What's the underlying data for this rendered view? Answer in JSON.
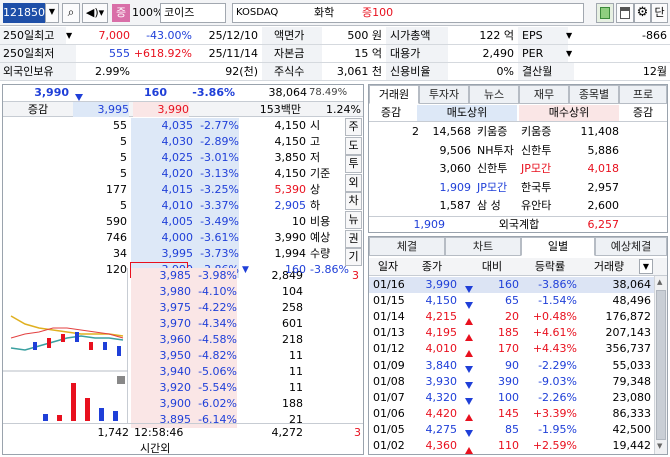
{
  "toolbar": {
    "code": "121850",
    "badge": "증",
    "margin": "100%",
    "name": "코이즈",
    "market": "KOSDAQ",
    "sector": "화학",
    "margin_text": "증100",
    "right_btn": "단"
  },
  "info": {
    "row1": {
      "label": "250일최고",
      "value": "7,000",
      "pct": "-43.00%",
      "date": "25/12/10",
      "k1": "액면가",
      "v1": "500 원",
      "k2": "시가총액",
      "v2": "122 억",
      "k3": "EPS",
      "v3": "-866"
    },
    "row2": {
      "label": "250일최저",
      "value": "555",
      "pct": "+618.92%",
      "date": "25/11/14",
      "k1": "자본금",
      "v1": "15 억",
      "k2": "대용가",
      "v2": "2,490",
      "k3": "PER",
      "v3": ""
    },
    "row3": {
      "label": "외국인보유",
      "value": "2.99%",
      "pct": "",
      "date": "92(천)",
      "k1": "주식수",
      "v1": "3,061 천",
      "k2": "신용비율",
      "v2": "0%",
      "k3": "결산월",
      "v3": "12월"
    }
  },
  "quote": {
    "price": "3,990",
    "change": "160",
    "pct": "-3.86%",
    "volume": "38,064",
    "vol_pct": "78.49%"
  },
  "orderbook": {
    "head": {
      "label": "증감",
      "ask_total": "3,995",
      "bid_price": "3,990",
      "amount": "153백만",
      "ratio": "1.24%"
    },
    "asks": [
      {
        "vol": "55",
        "price": "4,035",
        "pct": "-2.77%"
      },
      {
        "vol": "5",
        "price": "4,030",
        "pct": "-2.89%"
      },
      {
        "vol": "5",
        "price": "4,025",
        "pct": "-3.01%"
      },
      {
        "vol": "5",
        "price": "4,020",
        "pct": "-3.13%"
      },
      {
        "vol": "177",
        "price": "4,015",
        "pct": "-3.25%"
      },
      {
        "vol": "5",
        "price": "4,010",
        "pct": "-3.37%"
      },
      {
        "vol": "590",
        "price": "4,005",
        "pct": "-3.49%"
      },
      {
        "vol": "746",
        "price": "4,000",
        "pct": "-3.61%"
      },
      {
        "vol": "34",
        "price": "3,995",
        "pct": "-3.73%"
      },
      {
        "vol": "120",
        "price": "3,990",
        "pct": "-3.86%"
      }
    ],
    "bids": [
      {
        "price": "3,985",
        "pct": "-3.98%",
        "vol": "2,849"
      },
      {
        "price": "3,980",
        "pct": "-4.10%",
        "vol": "104"
      },
      {
        "price": "3,975",
        "pct": "-4.22%",
        "vol": "258"
      },
      {
        "price": "3,970",
        "pct": "-4.34%",
        "vol": "601"
      },
      {
        "price": "3,960",
        "pct": "-4.58%",
        "vol": "218"
      },
      {
        "price": "3,950",
        "pct": "-4.82%",
        "vol": "11"
      },
      {
        "price": "3,940",
        "pct": "-5.06%",
        "vol": "11"
      },
      {
        "price": "3,920",
        "pct": "-5.54%",
        "vol": "11"
      },
      {
        "price": "3,900",
        "pct": "-6.02%",
        "vol": "188"
      },
      {
        "price": "3,895",
        "pct": "-6.14%",
        "vol": "21"
      }
    ],
    "summary": [
      {
        "v": "4,150",
        "k": "시"
      },
      {
        "v": "4,150",
        "k": "고"
      },
      {
        "v": "3,850",
        "k": "저"
      },
      {
        "v": "4,150",
        "k": "기준"
      },
      {
        "v": "5,390",
        "k": "상"
      },
      {
        "v": "2,905",
        "k": "하"
      },
      {
        "v": "10",
        "k": "비용"
      },
      {
        "v": "3,990",
        "k": "예상"
      },
      {
        "v": "1,994",
        "k": "수량"
      },
      {
        "v": "160",
        "k": "-3.86%"
      }
    ],
    "side_buttons": [
      "주",
      "도",
      "투",
      "외",
      "차",
      "뉴",
      "권",
      "기"
    ],
    "foot": {
      "ask_total": "1,742",
      "time": "12:58:46",
      "bid_total": "4,272",
      "diff": "3",
      "after": "시간외"
    },
    "bid_mark": "3"
  },
  "broker": {
    "tabs": [
      "거래원",
      "투자자",
      "뉴스",
      "재무",
      "종목별",
      "프로"
    ],
    "head": [
      "증감",
      "매도상위",
      "매수상위",
      "증감"
    ],
    "rows": [
      {
        "d1": "2",
        "q1": "14,568",
        "n1": "키움증",
        "n2": "키움증",
        "q2": "11,408"
      },
      {
        "d1": "",
        "q1": "9,506",
        "n1": "NH투자",
        "n2": "신한투",
        "q2": "5,886"
      },
      {
        "d1": "",
        "q1": "3,060",
        "n1": "신한투",
        "n2": "JP모간",
        "q2": "4,018"
      },
      {
        "d1": "",
        "q1": "1,909",
        "n1": "JP모간",
        "n2": "한국투",
        "q2": "2,957"
      },
      {
        "d1": "",
        "q1": "1,587",
        "n1": "삼 성",
        "n2": "유안타",
        "q2": "2,600"
      }
    ],
    "foreign": {
      "q1": "1,909",
      "label": "외국계합",
      "q2": "6,257"
    }
  },
  "daily": {
    "tabs": [
      "체결",
      "차트",
      "일별",
      "예상체결"
    ],
    "head": [
      "일자",
      "종가",
      "대비",
      "등락률",
      "거래량"
    ],
    "rows": [
      {
        "date": "01/16",
        "close": "3,990",
        "dir": "down",
        "chg": "160",
        "pct": "-3.86%",
        "vol": "38,064"
      },
      {
        "date": "01/15",
        "close": "4,150",
        "dir": "down",
        "chg": "65",
        "pct": "-1.54%",
        "vol": "48,496"
      },
      {
        "date": "01/14",
        "close": "4,215",
        "dir": "up",
        "chg": "20",
        "pct": "+0.48%",
        "vol": "176,872"
      },
      {
        "date": "01/13",
        "close": "4,195",
        "dir": "up",
        "chg": "185",
        "pct": "+4.61%",
        "vol": "207,143"
      },
      {
        "date": "01/12",
        "close": "4,010",
        "dir": "up",
        "chg": "170",
        "pct": "+4.43%",
        "vol": "356,737"
      },
      {
        "date": "01/09",
        "close": "3,840",
        "dir": "down",
        "chg": "90",
        "pct": "-2.29%",
        "vol": "55,033"
      },
      {
        "date": "01/08",
        "close": "3,930",
        "dir": "down",
        "chg": "390",
        "pct": "-9.03%",
        "vol": "79,348"
      },
      {
        "date": "01/07",
        "close": "4,320",
        "dir": "down",
        "chg": "100",
        "pct": "-2.26%",
        "vol": "23,080"
      },
      {
        "date": "01/06",
        "close": "4,420",
        "dir": "up",
        "chg": "145",
        "pct": "+3.39%",
        "vol": "86,333"
      },
      {
        "date": "01/05",
        "close": "4,275",
        "dir": "down",
        "chg": "85",
        "pct": "-1.95%",
        "vol": "42,500"
      },
      {
        "date": "01/02",
        "close": "4,360",
        "dir": "up",
        "chg": "110",
        "pct": "+2.59%",
        "vol": "19,442"
      }
    ]
  },
  "colors": {
    "up": "#e8101e",
    "down": "#1f3fd8",
    "ask_bg": "#dde8f7",
    "bid_bg": "#fae6e6"
  }
}
